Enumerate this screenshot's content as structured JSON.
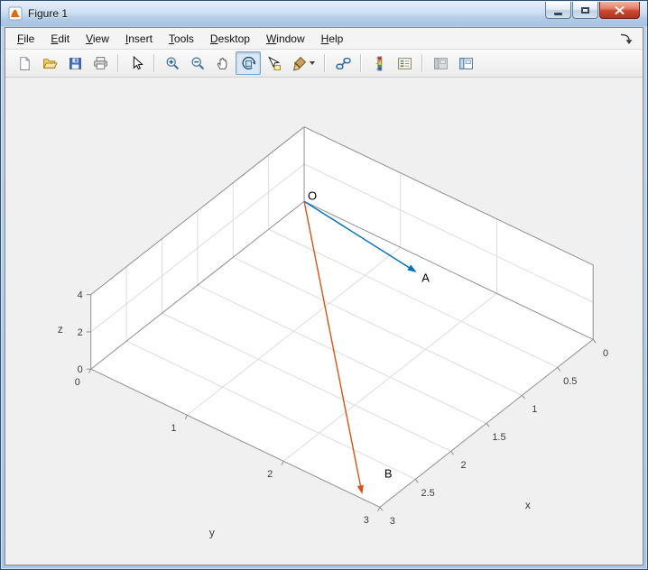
{
  "window": {
    "title": "Figure 1"
  },
  "menu": {
    "items": [
      {
        "label": "File",
        "accel": 0
      },
      {
        "label": "Edit",
        "accel": 0
      },
      {
        "label": "View",
        "accel": 0
      },
      {
        "label": "Insert",
        "accel": 0
      },
      {
        "label": "Tools",
        "accel": 0
      },
      {
        "label": "Desktop",
        "accel": 0
      },
      {
        "label": "Window",
        "accel": 0
      },
      {
        "label": "Help",
        "accel": 0
      }
    ]
  },
  "toolbar": {
    "groups": [
      [
        {
          "name": "new-figure",
          "icon": "new-doc"
        },
        {
          "name": "open-file",
          "icon": "open-folder"
        },
        {
          "name": "save-figure",
          "icon": "save"
        },
        {
          "name": "print-figure",
          "icon": "print"
        }
      ],
      [
        {
          "name": "edit-plot",
          "icon": "pointer"
        }
      ],
      [
        {
          "name": "zoom-in",
          "icon": "zoom-in"
        },
        {
          "name": "zoom-out",
          "icon": "zoom-out"
        },
        {
          "name": "pan",
          "icon": "hand"
        },
        {
          "name": "rotate-3d",
          "icon": "rotate-3d",
          "active": true
        },
        {
          "name": "data-cursor",
          "icon": "data-cursor"
        },
        {
          "name": "brush-data",
          "icon": "brush",
          "dropdown": true
        }
      ],
      [
        {
          "name": "link-plot",
          "icon": "link-plot"
        }
      ],
      [
        {
          "name": "insert-colorbar",
          "icon": "colorbar"
        },
        {
          "name": "insert-legend",
          "icon": "legend"
        }
      ],
      [
        {
          "name": "hide-plot-tools",
          "icon": "plot-tools-off"
        },
        {
          "name": "show-plot-tools",
          "icon": "plot-tools-on"
        }
      ]
    ]
  },
  "chart_data": {
    "type": "line",
    "subtype": "3d-vector-plot",
    "view": {
      "azimuth": -37.5,
      "elevation": 30
    },
    "title": "",
    "xlabel": "x",
    "ylabel": "y",
    "zlabel": "z",
    "xlim": [
      0,
      3
    ],
    "ylim": [
      0,
      3
    ],
    "zlim": [
      0,
      4
    ],
    "xticks": [
      0,
      0.5,
      1,
      1.5,
      2,
      2.5,
      3
    ],
    "yticks": [
      0,
      1,
      2,
      3
    ],
    "zticks": [
      0,
      2,
      4
    ],
    "grid": true,
    "series": [
      {
        "name": "OA",
        "kind": "vector",
        "from": [
          0,
          0,
          0
        ],
        "to": [
          0.45,
          1.5,
          1.25
        ],
        "color": "#0072BD"
      },
      {
        "name": "OB",
        "kind": "vector",
        "from": [
          0,
          0,
          0
        ],
        "to": [
          2.95,
          2.78,
          0
        ],
        "color": "#D95319"
      }
    ],
    "point_labels": [
      {
        "text": "O",
        "at": [
          0,
          0,
          0
        ],
        "dx": 9,
        "dy": -5
      },
      {
        "text": "A",
        "at": [
          0.45,
          1.5,
          1.25
        ],
        "dx": 10,
        "dy": 7
      },
      {
        "text": "B",
        "at": [
          2.95,
          2.78,
          0
        ],
        "dx": 29,
        "dy": -22
      }
    ],
    "colors": {
      "wall": "#ffffff",
      "grid": "#dcdcdc",
      "edge": "#8f8f8f",
      "tick_text": "#3b3b3b",
      "label_text": "#3b3b3b",
      "figure_bg": "#f0f0f0"
    }
  }
}
